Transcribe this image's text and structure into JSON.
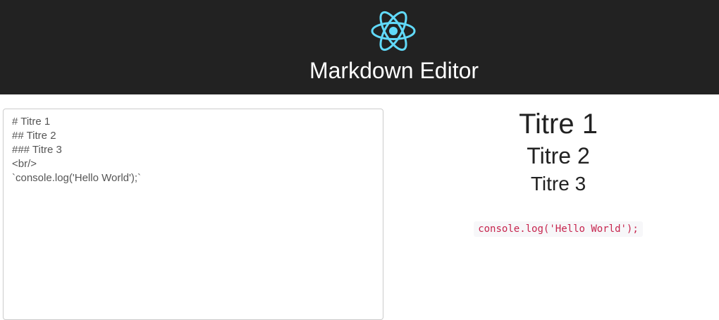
{
  "header": {
    "title": "Markdown Editor",
    "logo_icon": "react-logo-icon",
    "logo_color": "#61dafb",
    "background": "#222222"
  },
  "editor": {
    "value": "# Titre 1\n## Titre 2\n### Titre 3\n<br/>\n`console.log('Hello World');`"
  },
  "preview": {
    "h1": "Titre 1",
    "h2": "Titre 2",
    "h3": "Titre 3",
    "code": "console.log('Hello World');",
    "code_color": "#c7254e"
  }
}
